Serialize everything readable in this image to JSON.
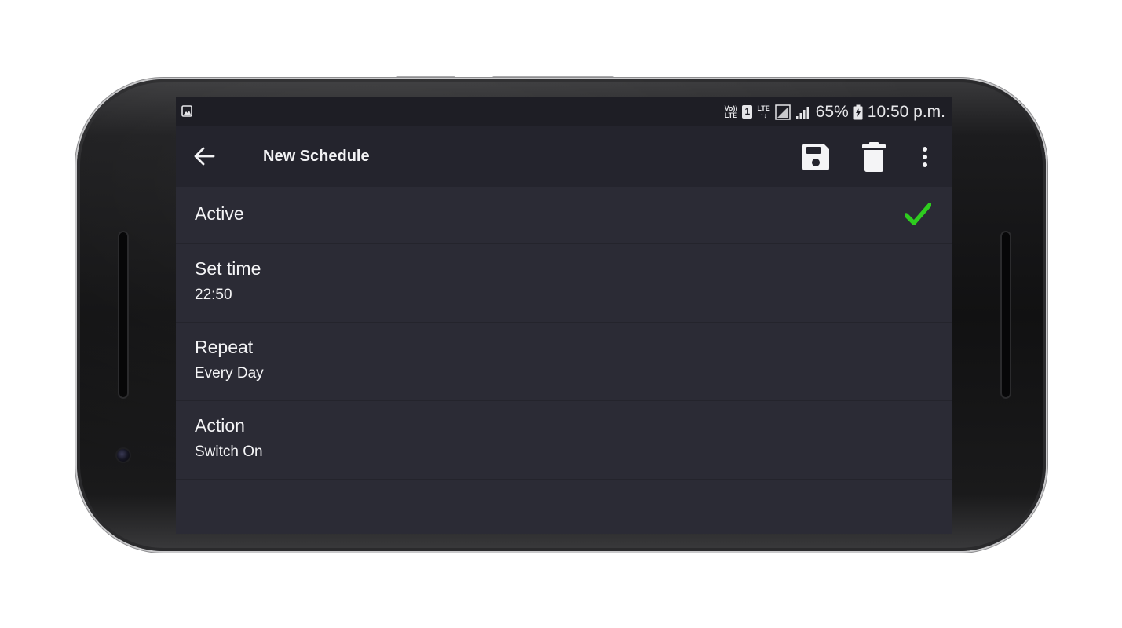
{
  "statusbar": {
    "volte_top": "Vo))",
    "volte_bottom": "LTE",
    "sim_slot": "1",
    "lte_top": "LTE",
    "lte_bottom": "↑↓",
    "battery_percent": "65%",
    "time": "10:50 p.m."
  },
  "toolbar": {
    "title": "New Schedule",
    "back_icon": "arrow-left-icon",
    "save_icon": "floppy-disk-icon",
    "delete_icon": "trash-icon",
    "overflow_icon": "more-vertical-icon"
  },
  "settings": {
    "active": {
      "label": "Active",
      "checked": true,
      "check_color": "#2ecc1f"
    },
    "set_time": {
      "label": "Set time",
      "value": "22:50"
    },
    "repeat": {
      "label": "Repeat",
      "value": "Every Day"
    },
    "action": {
      "label": "Action",
      "value": "Switch On"
    }
  },
  "colors": {
    "screen_bg": "#2b2b35",
    "toolbar_bg": "#24242d",
    "statusbar_bg": "#1e1e25",
    "text": "#f4f4f6"
  }
}
